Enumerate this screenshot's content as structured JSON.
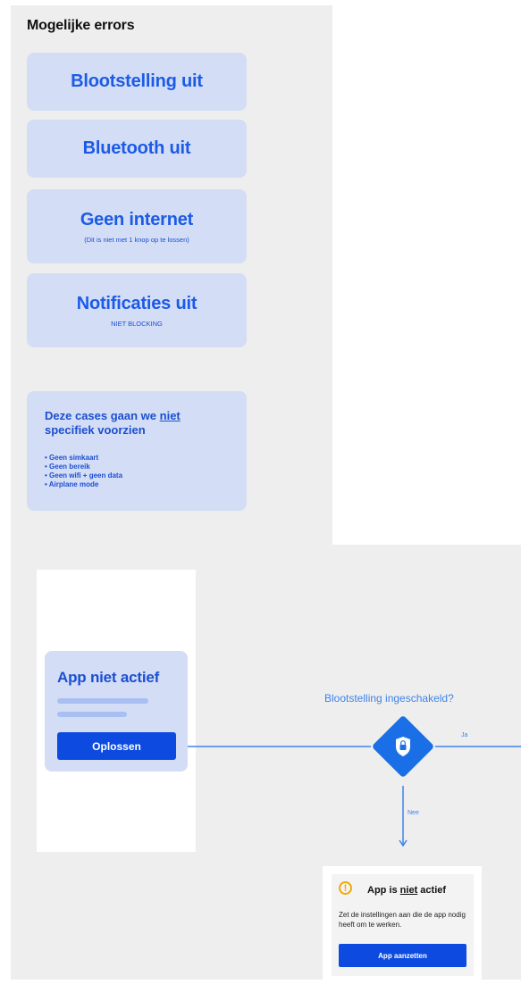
{
  "top": {
    "title": "Mogelijke errors",
    "cards": [
      {
        "label": "Blootstelling uit",
        "sub": ""
      },
      {
        "label": "Bluetooth uit",
        "sub": ""
      },
      {
        "label": "Geen internet",
        "sub": "(Dit is niet met 1 knop op te lossen)"
      },
      {
        "label": "Notificaties uit",
        "sub": "NIET BLOCKING"
      }
    ],
    "cases": {
      "title_pre": "Deze cases gaan we ",
      "title_em": "niet",
      "title_post": " specifiek voorzien",
      "items": [
        "• Geen simkaart",
        "• Geen bereik",
        "• Geen wifi + geen data",
        "• Airplane mode"
      ]
    }
  },
  "flow": {
    "app_card": {
      "title": "App niet actief",
      "button": "Oplossen"
    },
    "question": "Blootstelling ingeschakeld?",
    "yes_label": "Ja",
    "no_label": "Nee",
    "result": {
      "title_pre": "App is ",
      "title_em": "niet",
      "title_post": " actief",
      "description": "Zet de instellingen aan die de app nodig heeft om te werken.",
      "button": "App aanzetten",
      "icon": "!"
    }
  },
  "colors": {
    "accent": "#0d4be0",
    "card_bg": "#d4ddf6",
    "flow_line": "#3e84e8",
    "warning": "#f2a900"
  }
}
